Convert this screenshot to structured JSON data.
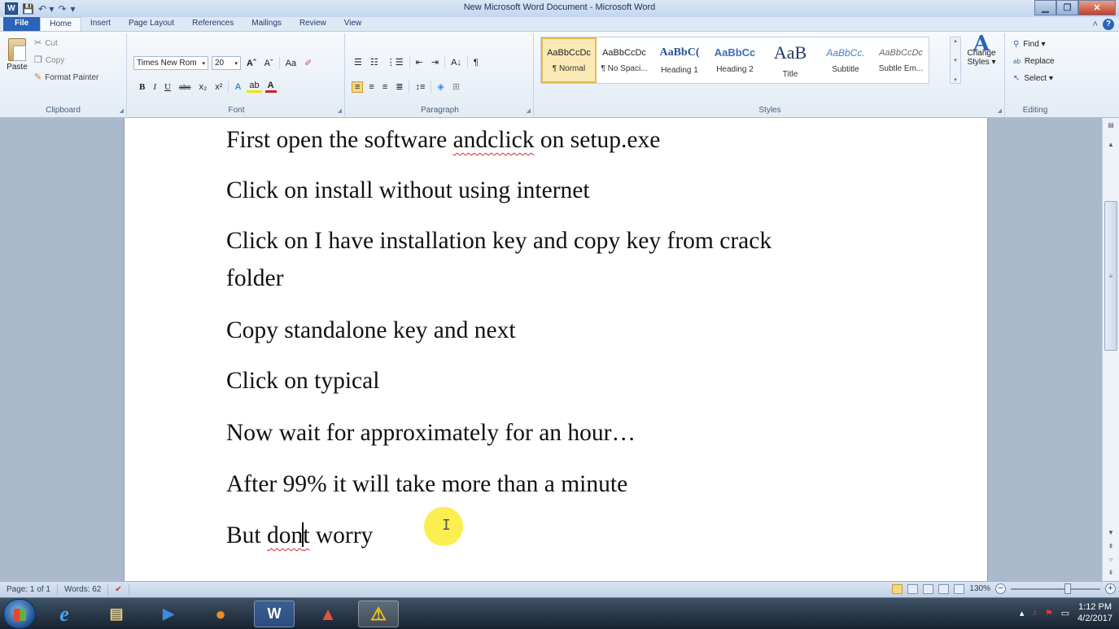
{
  "window": {
    "title": "New Microsoft Word Document - Microsoft Word"
  },
  "qat": {
    "logo": "W",
    "save": "💾",
    "undo": "↶ ▾",
    "redo": "↷",
    "customize": "▾"
  },
  "tabs": [
    "File",
    "Home",
    "Insert",
    "Page Layout",
    "References",
    "Mailings",
    "Review",
    "View"
  ],
  "clipboard": {
    "paste": "Paste",
    "cut": "Cut",
    "copy": "Copy",
    "format_painter": "Format Painter",
    "label": "Clipboard"
  },
  "font": {
    "name": "Times New Rom",
    "size": "20",
    "grow": "Aˆ",
    "shrink": "Aˇ",
    "change_case": "Aa",
    "clear": "✐",
    "bold": "B",
    "italic": "I",
    "underline": "U",
    "strike": "abc",
    "subscript": "x₂",
    "superscript": "x²",
    "effects": "A",
    "highlight": "ab",
    "color": "A",
    "label": "Font"
  },
  "paragraph": {
    "bullets": "☰",
    "numbering": "☷",
    "multilevel": "⋮☰",
    "dec_indent": "⇤",
    "inc_indent": "⇥",
    "sort": "A↓",
    "show_marks": "¶",
    "label": "Paragraph"
  },
  "styles": {
    "items": [
      {
        "preview": "AaBbCcDc",
        "name": "¶ Normal"
      },
      {
        "preview": "AaBbCcDc",
        "name": "¶ No Spaci..."
      },
      {
        "preview": "AaBbC(",
        "name": "Heading 1"
      },
      {
        "preview": "AaBbCc",
        "name": "Heading 2"
      },
      {
        "preview": "AaB",
        "name": "Title"
      },
      {
        "preview": "AaBbCc.",
        "name": "Subtitle"
      },
      {
        "preview": "AaBbCcDc",
        "name": "Subtle Em..."
      }
    ],
    "change": "Change Styles ▾",
    "label": "Styles"
  },
  "editing": {
    "find": "Find ▾",
    "replace": "Replace",
    "select": "Select ▾",
    "label": "Editing"
  },
  "document": {
    "paragraphs": [
      "First open the software andclick on setup.exe",
      "Click on install without using internet",
      "Click on I have installation key and copy key from crack",
      "folder",
      "Copy standalone key and next",
      "Click on typical",
      "Now wait for approximately for an hour…",
      "After 99% it will take more than a minute",
      "But dont worry"
    ],
    "p1_before": "First open the software ",
    "p1_misspelled": "andclick",
    "p1_after": " on setup.exe",
    "last_before": "But ",
    "last_misspelled_a": "don",
    "last_misspelled_b": "t",
    "last_after": " worry"
  },
  "status": {
    "page": "Page: 1 of 1",
    "words": "Words: 62",
    "zoom": "130%",
    "zoom_minus": "−",
    "zoom_plus": "+"
  },
  "taskbar": {
    "time": "1:12 PM",
    "date": "4/2/2017"
  },
  "colors": {
    "accent": "#2a63b8",
    "spell_error": "#d12a2a",
    "cursor_highlight": "#faeb1e"
  }
}
